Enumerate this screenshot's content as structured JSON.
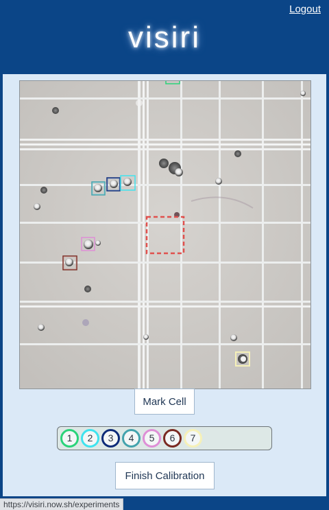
{
  "header": {
    "brand": "visiri",
    "logout_label": "Logout"
  },
  "colors": {
    "header_bg": "#0b4587",
    "panel_bg": "#dbe9f7",
    "target_box": "#e0504d"
  },
  "image": {
    "description_icon": "microscope-hemocytometer-image"
  },
  "buttons": {
    "mark_cell": "Mark Cell",
    "finish_calibration": "Finish Calibration"
  },
  "cell_selector": {
    "chips": [
      {
        "label": "1",
        "color": "#2bd37a"
      },
      {
        "label": "2",
        "color": "#3fe3ee"
      },
      {
        "label": "3",
        "color": "#0d2b78"
      },
      {
        "label": "4",
        "color": "#43a3ad"
      },
      {
        "label": "5",
        "color": "#de8fd6"
      },
      {
        "label": "6",
        "color": "#7a2a22"
      },
      {
        "label": "7",
        "color": "#f6f1b8"
      }
    ]
  },
  "statusbar": {
    "url": "https://visiri.now.sh/experiments"
  }
}
